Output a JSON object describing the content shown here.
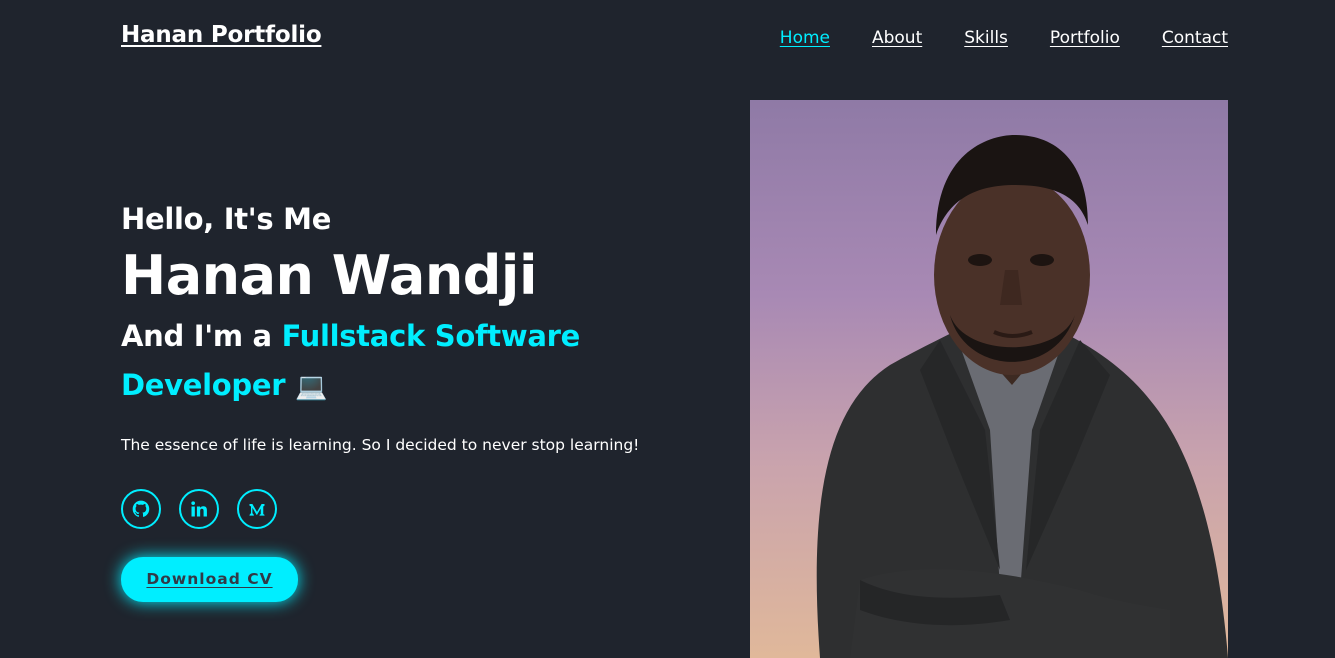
{
  "header": {
    "logo": "Hanan Portfolio",
    "nav": [
      {
        "label": "Home",
        "active": true
      },
      {
        "label": "About",
        "active": false
      },
      {
        "label": "Skills",
        "active": false
      },
      {
        "label": "Portfolio",
        "active": false
      },
      {
        "label": "Contact",
        "active": false
      }
    ]
  },
  "hero": {
    "greeting": "Hello, It's Me",
    "name": "Hanan Wandji",
    "role_prefix": "And I'm a ",
    "role": "Fullstack Software Developer",
    "role_emoji": "💻",
    "tagline": "The essence of life is learning. So I decided to never stop learning!",
    "socials": [
      {
        "icon": "github-icon"
      },
      {
        "icon": "linkedin-icon"
      },
      {
        "icon": "medium-icon"
      }
    ],
    "cta_label": "Download CV"
  },
  "colors": {
    "background": "#1f242d",
    "accent": "#00eeff",
    "text": "#ffffff",
    "button_text": "#323946"
  }
}
